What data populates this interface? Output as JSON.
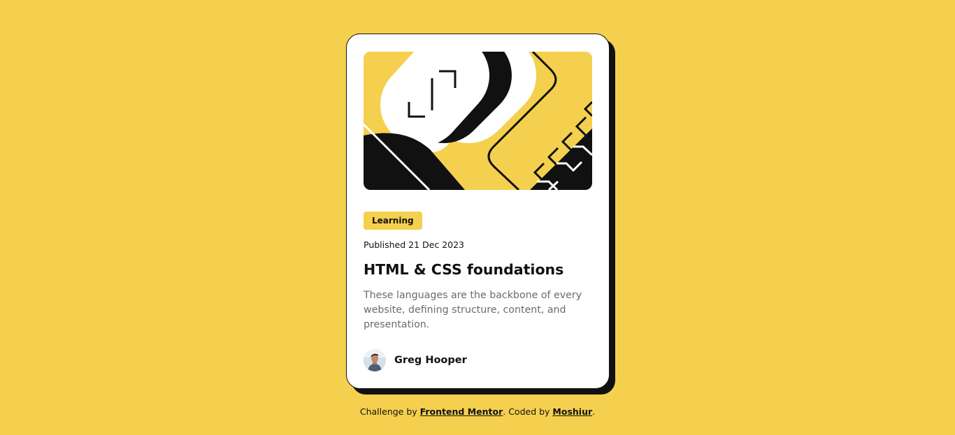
{
  "colors": {
    "background": "#F4D04E",
    "ink": "#111111",
    "card": "#FFFFFF",
    "muted_text": "#6B6B6B"
  },
  "card": {
    "hero_image": "abstract-illustration",
    "tag": "Learning",
    "published": "Published 21 Dec 2023",
    "title": "HTML & CSS foundations",
    "description": "These languages are the backbone of every website, defining structure, content, and presentation.",
    "author": {
      "name": "Greg Hooper",
      "avatar": "avatar-photo"
    }
  },
  "footer": {
    "prefix": "Challenge by ",
    "challenge_link": "Frontend Mentor",
    "middle": ". Coded by ",
    "coder_link": "Moshiur",
    "suffix": "."
  }
}
